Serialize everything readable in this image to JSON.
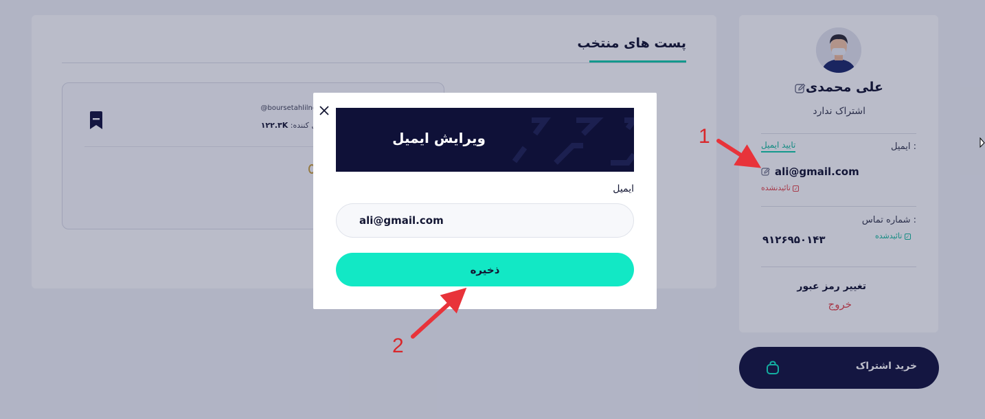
{
  "main": {
    "section_title": "پست های منتخب",
    "post": {
      "handle": "@boursetahlilnovin",
      "followers_label": "دنبال کننده:",
      "followers_value": "۱۲۲.۳K"
    }
  },
  "profile": {
    "name": "علی محمدی",
    "subscription_status": "اشتراک ندارد",
    "email_label": "ایمیل :",
    "verify_email_link": "تایید ایمیل",
    "email": "ali@gmail.com",
    "email_status": "تائیدنشده",
    "phone_label": "شماره تماس :",
    "phone": "۹۱۲۶۹۵۰۱۴۳",
    "phone_status": "تائیدشده",
    "change_password": "تغییر رمز عبور",
    "logout": "خروج",
    "buy_subscription": "خرید اشتراک"
  },
  "modal": {
    "title": "ویرایش ایمیل",
    "field_label": "ایمیل",
    "email_value": "ali@gmail.com",
    "save_label": "ذخیره"
  },
  "annotations": {
    "step1": "1",
    "step2": "2"
  },
  "colors": {
    "accent": "#12e8c5",
    "dark": "#0f1138",
    "danger": "#e0444a",
    "success": "#12b89a",
    "arrow": "#e8333a"
  }
}
